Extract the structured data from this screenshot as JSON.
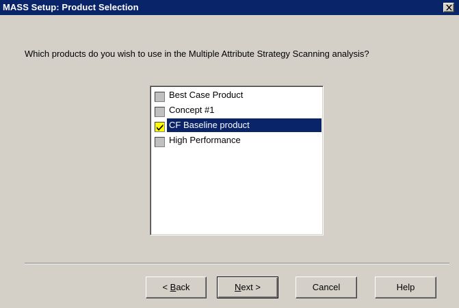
{
  "window": {
    "title": "MASS Setup: Product Selection",
    "close_icon": "close-x-icon"
  },
  "prompt": {
    "question": "Which products do you wish to use in the Multiple Attribute Strategy Scanning analysis?"
  },
  "products": {
    "items": [
      {
        "label": "Best Case Product",
        "checked": false,
        "selected": false
      },
      {
        "label": "Concept #1",
        "checked": false,
        "selected": false
      },
      {
        "label": "CF Baseline product",
        "checked": true,
        "selected": true
      },
      {
        "label": "High Performance",
        "checked": false,
        "selected": false
      }
    ]
  },
  "buttons": {
    "back_prefix": "< ",
    "back_mnemonic": "B",
    "back_rest": "ack",
    "next_mnemonic": "N",
    "next_rest": "ext >",
    "cancel_label": "Cancel",
    "help_label": "Help"
  },
  "colors": {
    "titlebar": "#0a246a",
    "dialog_face": "#d4d0c8",
    "selection": "#0a246a",
    "checked_box": "#ffff00"
  }
}
